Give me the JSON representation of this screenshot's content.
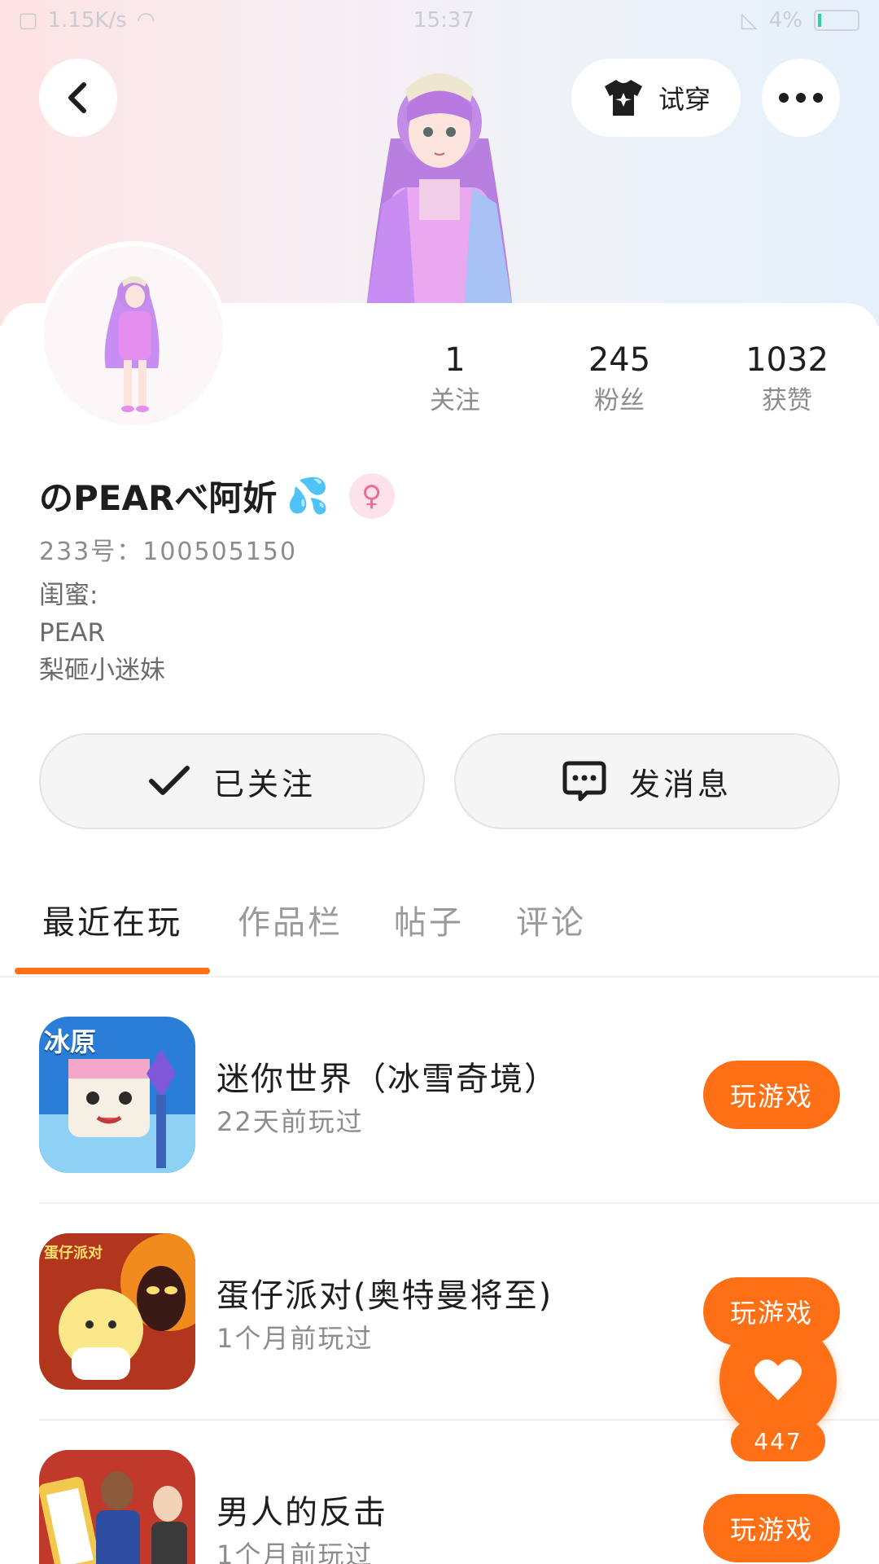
{
  "status_bar": {
    "speed": "1.15K/s",
    "time": "15:37",
    "battery": "4%"
  },
  "header": {
    "tryon_label": "试穿"
  },
  "profile": {
    "nickname": "のPEARべ阿妡",
    "nickname_emoji": "💦",
    "gender_symbol": "♀",
    "uid": "233号：100505150",
    "bio_lines": [
      "闺蜜:",
      "PEAR",
      "梨砸小迷妹"
    ]
  },
  "stats": [
    {
      "value": "1",
      "label": "关注"
    },
    {
      "value": "245",
      "label": "粉丝"
    },
    {
      "value": "1032",
      "label": "获赞"
    }
  ],
  "actions": {
    "follow_label": "已关注",
    "message_label": "发消息"
  },
  "tabs": [
    "最近在玩",
    "作品栏",
    "帖子",
    "评论"
  ],
  "games": [
    {
      "name": "迷你世界（冰雪奇境）",
      "last_played": "22天前玩过",
      "button": "玩游戏",
      "icon_text": "冰原"
    },
    {
      "name": "蛋仔派对(奥特曼将至)",
      "last_played": "1个月前玩过",
      "button": "玩游戏",
      "icon_text": "蛋仔派对"
    },
    {
      "name": "男人的反击",
      "last_played": "1个月前玩过",
      "button": "玩游戏",
      "icon_text": ""
    }
  ],
  "like": {
    "count": "447"
  },
  "colors": {
    "accent": "#ff7016",
    "text": "#1e1e1e",
    "muted": "#8c8c8c"
  }
}
